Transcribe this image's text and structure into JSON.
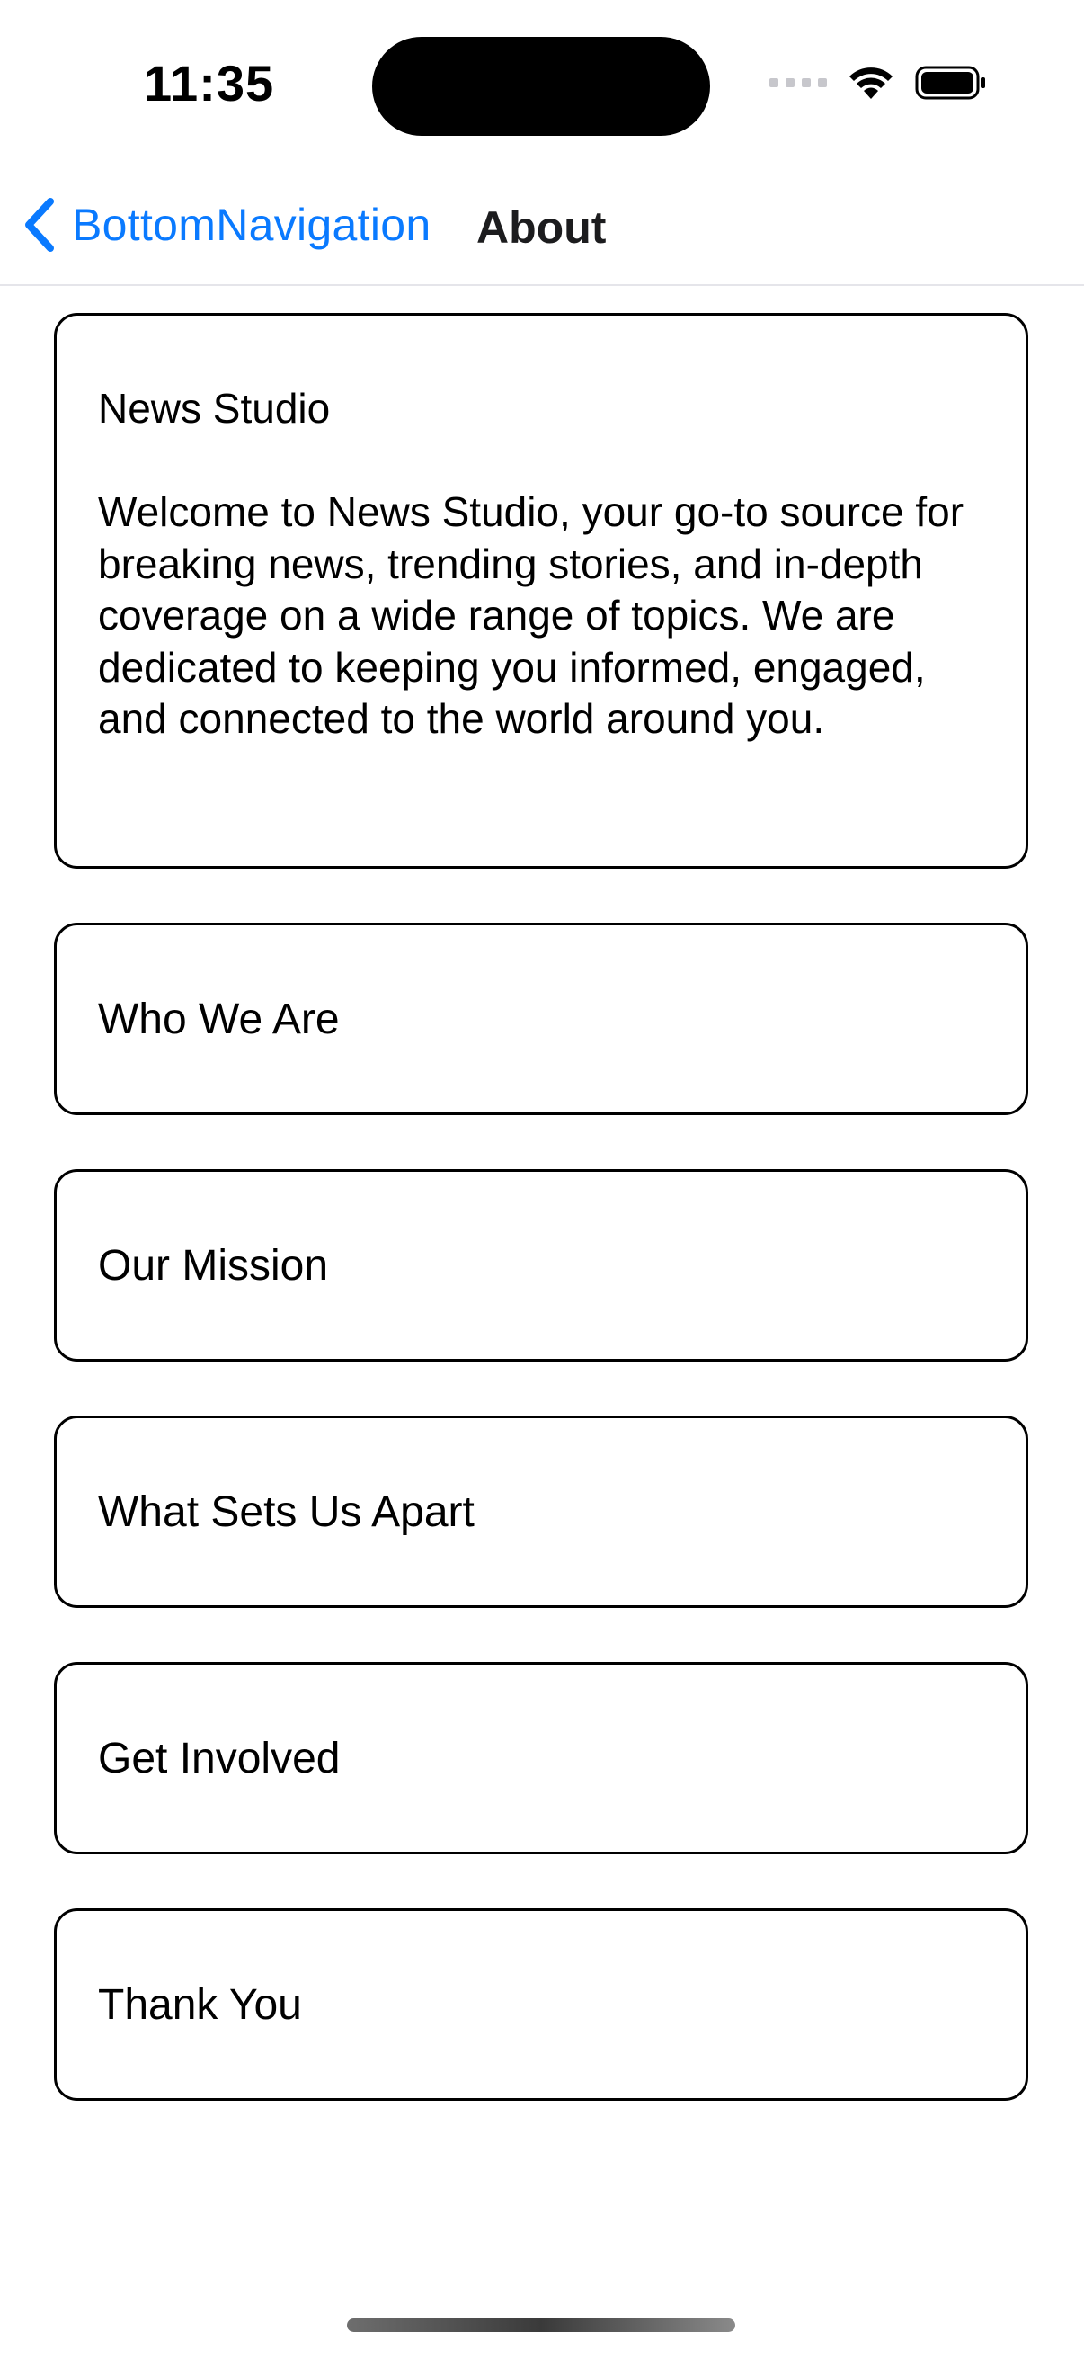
{
  "status_bar": {
    "time": "11:35"
  },
  "nav": {
    "back_label": "BottomNavigation",
    "title": "About"
  },
  "intro": {
    "title": "News Studio",
    "body": "Welcome to News Studio, your go-to source for breaking news, trending stories, and in-depth coverage on a wide range of topics. We are dedicated to keeping you informed, engaged, and connected to the world around you."
  },
  "sections": [
    {
      "label": "Who We Are"
    },
    {
      "label": "Our Mission"
    },
    {
      "label": "What Sets Us Apart"
    },
    {
      "label": "Get Involved"
    },
    {
      "label": "Thank You"
    }
  ],
  "colors": {
    "accent": "#0A7AFF",
    "card_border": "#000000",
    "background": "#FFFFFF"
  }
}
